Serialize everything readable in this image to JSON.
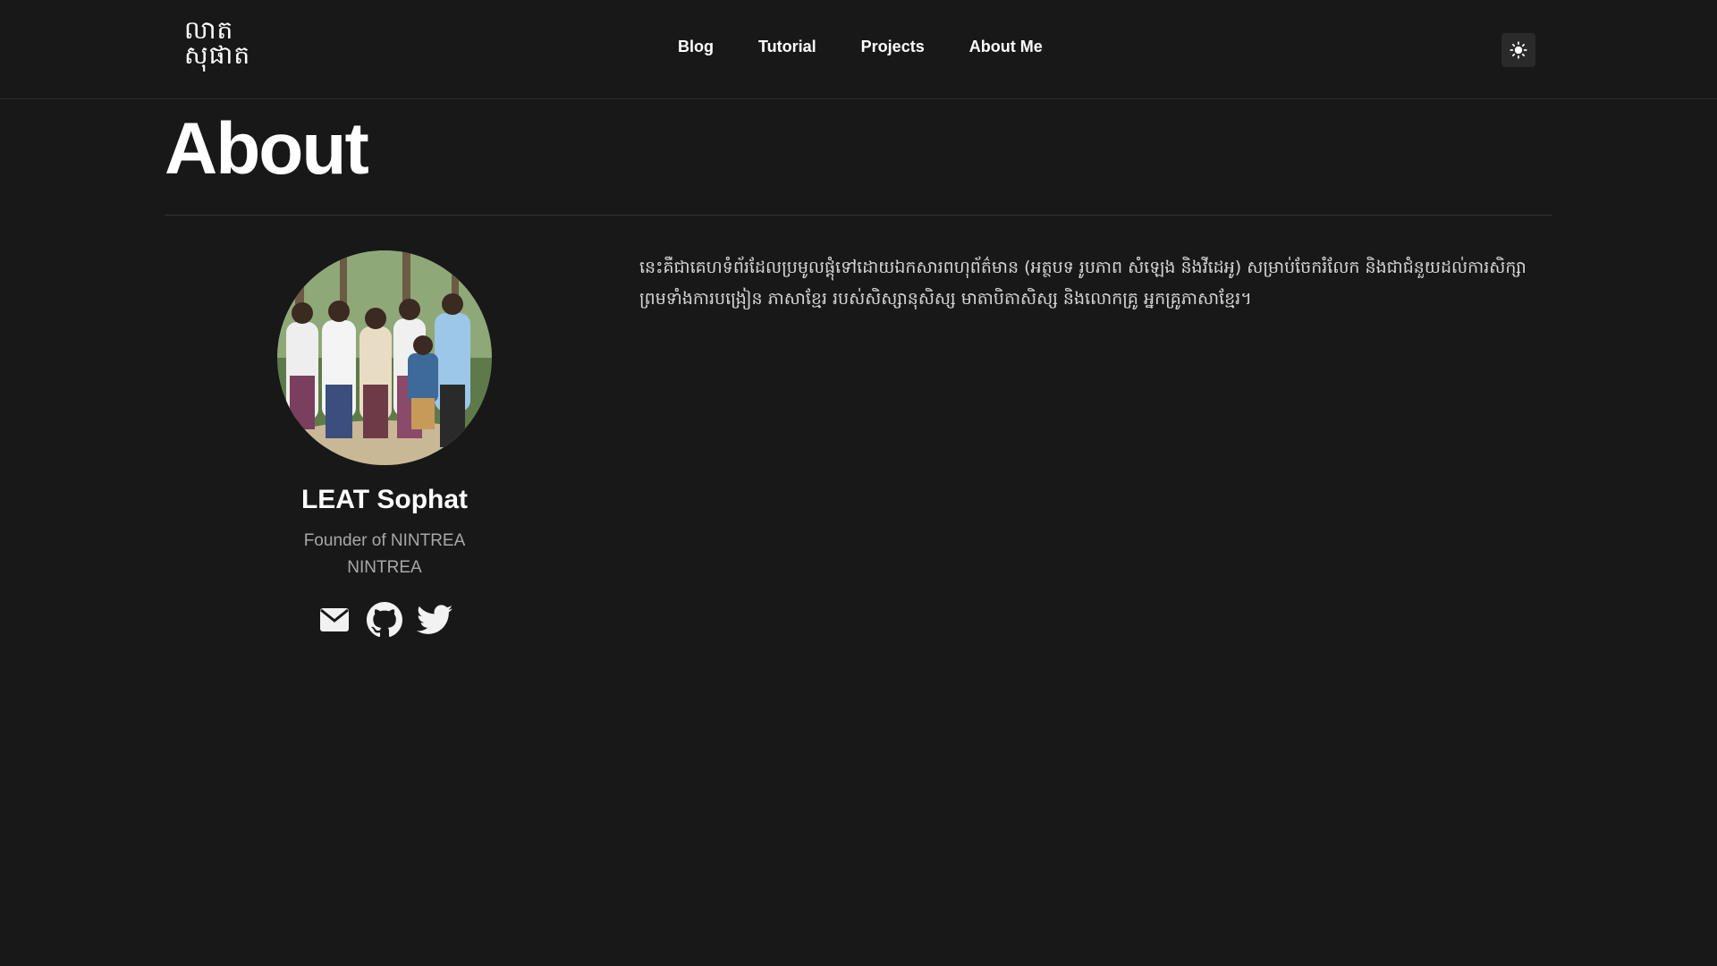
{
  "header": {
    "logo_text": "លាត\nសុផាត",
    "nav": [
      {
        "label": "Blog"
      },
      {
        "label": "Tutorial"
      },
      {
        "label": "Projects"
      },
      {
        "label": "About Me"
      }
    ],
    "theme_toggle_icon": "sun-icon"
  },
  "page": {
    "title": "About"
  },
  "profile": {
    "name": "LEAT Sophat",
    "role_line1": "Founder of NINTREA",
    "role_line2": "NINTREA",
    "socials": [
      {
        "icon": "mail-icon"
      },
      {
        "icon": "github-icon"
      },
      {
        "icon": "twitter-icon"
      }
    ]
  },
  "bio": "នេះគឺជាគេហទំព័រដែលប្រមូលផ្ដុំទៅដោយឯកសារពហុព័ត៌មាន (អត្ថបទ រូបភាព សំឡេង និងវីដេអូ) សម្រាប់ចែករំលែក និងជាជំនួយដល់ការសិក្សា ព្រមទាំងការបង្រៀន ភាសាខ្មែរ របស់សិស្សានុសិស្ស មាតាបិតាសិស្ស និងលោកគ្រូ អ្នកគ្រូភាសាខ្មែរ។",
  "colors": {
    "background": "#181818",
    "text": "#ffffff",
    "muted": "#a8a8a8"
  }
}
